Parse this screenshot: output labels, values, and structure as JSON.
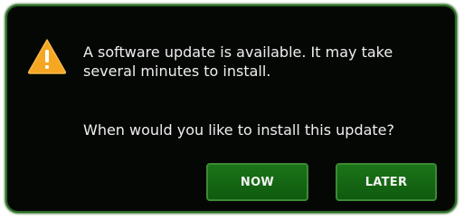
{
  "dialog": {
    "icon": "warning-icon",
    "message": "A software update is available. It may take several minutes to install.",
    "question": "When would you like to install this update?",
    "buttons": {
      "now_label": "NOW",
      "later_label": "LATER"
    },
    "colors": {
      "background": "#050705",
      "border": "#2e6b28",
      "button": "#146614",
      "warning": "#f5a623"
    }
  }
}
